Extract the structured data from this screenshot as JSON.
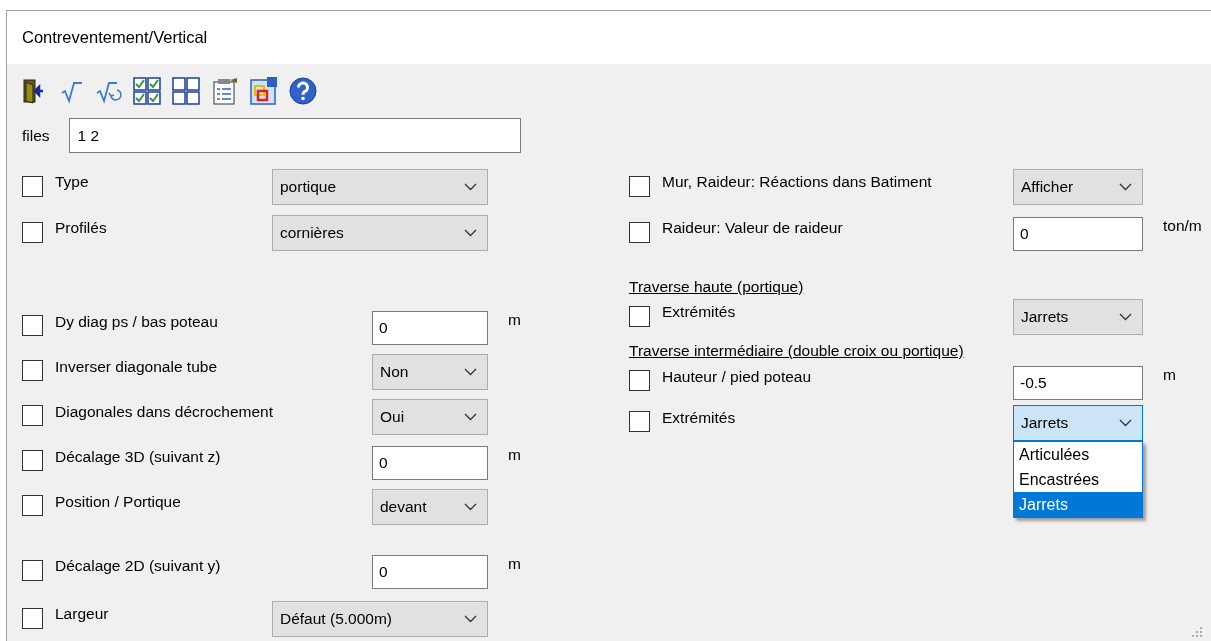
{
  "window": {
    "title": "Contreventement/Vertical"
  },
  "files": {
    "label": "files",
    "value": "1 2"
  },
  "left_groups": [
    [
      {
        "label": "Type",
        "checked": false,
        "kind": "longselect",
        "value": "portique"
      },
      {
        "label": "Profilés",
        "checked": false,
        "kind": "longselect",
        "value": "cornières"
      }
    ],
    [
      {
        "label": "Dy diag ps / bas poteau",
        "checked": false,
        "kind": "input",
        "value": "0",
        "unit": "m"
      },
      {
        "label": "Inverser diagonale tube",
        "checked": false,
        "kind": "select",
        "value": "Non"
      },
      {
        "label": "Diagonales dans décrochement",
        "checked": false,
        "kind": "select",
        "value": "Oui"
      },
      {
        "label": "Décalage 3D (suivant z)",
        "checked": false,
        "kind": "input",
        "value": "0",
        "unit": "m"
      },
      {
        "label": "Position / Portique",
        "checked": false,
        "kind": "select",
        "value": "devant"
      }
    ],
    [
      {
        "label": "Décalage 2D (suivant y)",
        "checked": false,
        "kind": "input",
        "value": "0",
        "unit": "m"
      },
      {
        "label": "Largeur",
        "checked": false,
        "kind": "longselect",
        "value": "Défaut (5.000m)"
      }
    ]
  ],
  "right": {
    "rows": [
      {
        "label": "Mur, Raideur: Réactions dans Batiment",
        "checked": false,
        "kind": "select",
        "value": "Afficher"
      },
      {
        "label": "Raideur: Valeur de raideur",
        "checked": false,
        "kind": "input",
        "value": "0",
        "unit": "ton/m"
      }
    ],
    "sections": [
      {
        "heading": "Traverse haute (portique)",
        "rows": [
          {
            "label": "Extrémités",
            "checked": false,
            "kind": "select",
            "value": "Jarrets"
          }
        ]
      },
      {
        "heading": "Traverse intermédiaire (double croix ou portique)",
        "rows": [
          {
            "label": "Hauteur / pied poteau",
            "checked": false,
            "kind": "input",
            "value": "-0.5",
            "unit": "m"
          },
          {
            "label": "Extrémités",
            "checked": false,
            "kind": "select",
            "value": "Jarrets",
            "open": true,
            "options": [
              {
                "label": "Articulées",
                "selected": false
              },
              {
                "label": "Encastrées",
                "selected": false
              },
              {
                "label": "Jarrets",
                "selected": true
              }
            ]
          }
        ]
      }
    ]
  }
}
